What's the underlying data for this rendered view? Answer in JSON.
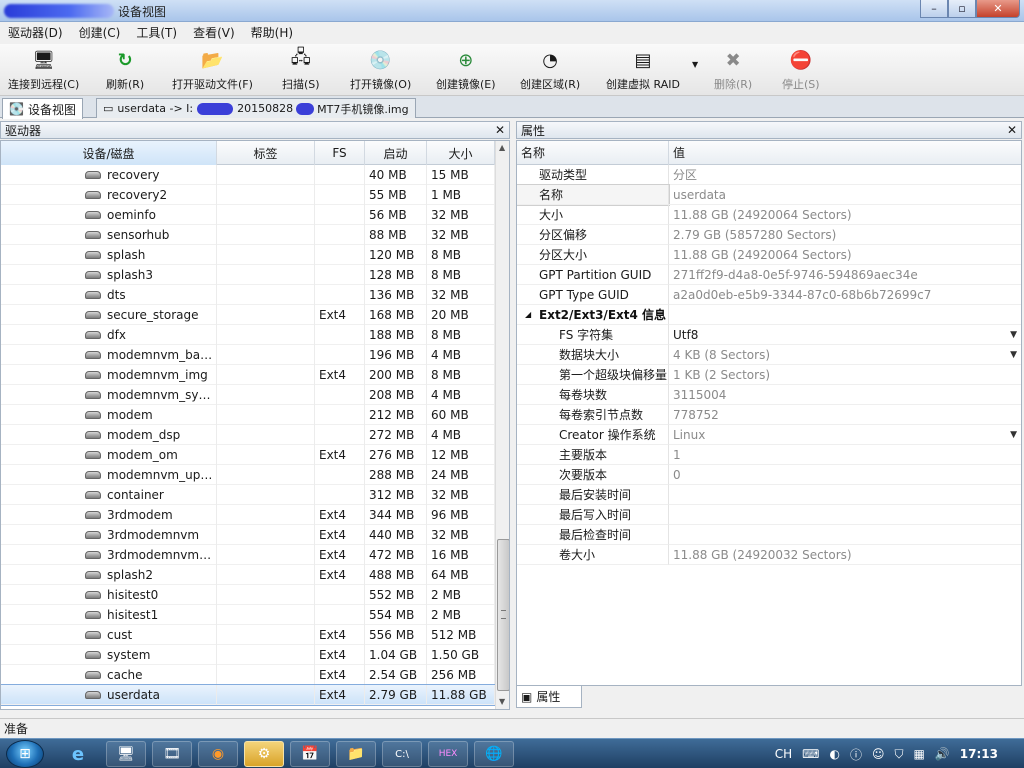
{
  "window": {
    "title": "设备视图",
    "minimize": "–",
    "maximize": "▫",
    "close": "✕"
  },
  "menu": [
    "驱动器(D)",
    "创建(C)",
    "工具(T)",
    "查看(V)",
    "帮助(H)"
  ],
  "toolbar": {
    "connect": "连接到远程(C)",
    "refresh": "刷新(R)",
    "open_driver_file": "打开驱动文件(F)",
    "scan": "扫描(S)",
    "open_image": "打开镜像(O)",
    "create_image": "创建镜像(E)",
    "create_region": "创建区域(R)",
    "create_virtual_raid": "创建虚拟 RAID",
    "delete": "删除(R)",
    "stop": "停止(S)"
  },
  "doc_tabs": {
    "device_view": "设备视图",
    "image_tab_prefix": "userdata -> I:",
    "image_tab_date": "20150828",
    "image_tab_file": "MT7手机镜像.img"
  },
  "left_panel": {
    "title": "驱动器",
    "columns": {
      "device": "设备/磁盘",
      "label": "标签",
      "fs": "FS",
      "start": "启动",
      "size": "大小"
    },
    "rows": [
      {
        "name": "recovery",
        "label": "",
        "fs": "",
        "start": "40 MB",
        "size": "15 MB"
      },
      {
        "name": "recovery2",
        "label": "",
        "fs": "",
        "start": "55 MB",
        "size": "1 MB"
      },
      {
        "name": "oeminfo",
        "label": "",
        "fs": "",
        "start": "56 MB",
        "size": "32 MB"
      },
      {
        "name": "sensorhub",
        "label": "",
        "fs": "",
        "start": "88 MB",
        "size": "32 MB"
      },
      {
        "name": "splash",
        "label": "",
        "fs": "",
        "start": "120 MB",
        "size": "8 MB"
      },
      {
        "name": "splash3",
        "label": "",
        "fs": "",
        "start": "128 MB",
        "size": "8 MB"
      },
      {
        "name": "dts",
        "label": "",
        "fs": "",
        "start": "136 MB",
        "size": "32 MB"
      },
      {
        "name": "secure_storage",
        "label": "",
        "fs": "Ext4",
        "start": "168 MB",
        "size": "20 MB"
      },
      {
        "name": "dfx",
        "label": "",
        "fs": "",
        "start": "188 MB",
        "size": "8 MB"
      },
      {
        "name": "modemnvm_bac...",
        "label": "",
        "fs": "",
        "start": "196 MB",
        "size": "4 MB"
      },
      {
        "name": "modemnvm_img",
        "label": "",
        "fs": "Ext4",
        "start": "200 MB",
        "size": "8 MB"
      },
      {
        "name": "modemnvm_syst...",
        "label": "",
        "fs": "",
        "start": "208 MB",
        "size": "4 MB"
      },
      {
        "name": "modem",
        "label": "",
        "fs": "",
        "start": "212 MB",
        "size": "60 MB"
      },
      {
        "name": "modem_dsp",
        "label": "",
        "fs": "",
        "start": "272 MB",
        "size": "4 MB"
      },
      {
        "name": "modem_om",
        "label": "",
        "fs": "Ext4",
        "start": "276 MB",
        "size": "12 MB"
      },
      {
        "name": "modemnvm_upd...",
        "label": "",
        "fs": "",
        "start": "288 MB",
        "size": "24 MB"
      },
      {
        "name": "container",
        "label": "",
        "fs": "",
        "start": "312 MB",
        "size": "32 MB"
      },
      {
        "name": "3rdmodem",
        "label": "",
        "fs": "Ext4",
        "start": "344 MB",
        "size": "96 MB"
      },
      {
        "name": "3rdmodemnvm",
        "label": "",
        "fs": "Ext4",
        "start": "440 MB",
        "size": "32 MB"
      },
      {
        "name": "3rdmodemnvmb...",
        "label": "",
        "fs": "Ext4",
        "start": "472 MB",
        "size": "16 MB"
      },
      {
        "name": "splash2",
        "label": "",
        "fs": "Ext4",
        "start": "488 MB",
        "size": "64 MB"
      },
      {
        "name": "hisitest0",
        "label": "",
        "fs": "",
        "start": "552 MB",
        "size": "2 MB"
      },
      {
        "name": "hisitest1",
        "label": "",
        "fs": "",
        "start": "554 MB",
        "size": "2 MB"
      },
      {
        "name": "cust",
        "label": "",
        "fs": "Ext4",
        "start": "556 MB",
        "size": "512 MB"
      },
      {
        "name": "system",
        "label": "",
        "fs": "Ext4",
        "start": "1.04 GB",
        "size": "1.50 GB"
      },
      {
        "name": "cache",
        "label": "",
        "fs": "Ext4",
        "start": "2.54 GB",
        "size": "256 MB"
      },
      {
        "name": "userdata",
        "label": "",
        "fs": "Ext4",
        "start": "2.79 GB",
        "size": "11.88 GB",
        "selected": true
      }
    ]
  },
  "right_panel": {
    "title": "属性",
    "columns": {
      "name": "名称",
      "value": "值"
    },
    "props": [
      {
        "name": "驱动类型",
        "value": "分区",
        "indent": 1
      },
      {
        "name": "名称",
        "value": "userdata",
        "indent": 1,
        "sel": true
      },
      {
        "name": "大小",
        "value": "11.88 GB (24920064 Sectors)",
        "indent": 1
      },
      {
        "name": "分区偏移",
        "value": "2.79 GB (5857280 Sectors)",
        "indent": 1
      },
      {
        "name": "分区大小",
        "value": "11.88 GB (24920064 Sectors)",
        "indent": 1
      },
      {
        "name": "GPT Partition GUID",
        "value": "271ff2f9-d4a8-0e5f-9746-594869aec34e",
        "indent": 1
      },
      {
        "name": "GPT Type GUID",
        "value": "a2a0d0eb-e5b9-3344-87c0-68b6b72699c7",
        "indent": 1
      },
      {
        "name": "Ext2/Ext3/Ext4 信息",
        "value": "",
        "indent": 0,
        "group": true
      },
      {
        "name": "FS 字符集",
        "value": "Utf8",
        "indent": 2,
        "dropdown": true,
        "dark": true
      },
      {
        "name": "数据块大小",
        "value": "4 KB (8 Sectors)",
        "indent": 2,
        "dropdown": true
      },
      {
        "name": "第一个超级块偏移量",
        "value": "1 KB (2 Sectors)",
        "indent": 2
      },
      {
        "name": "每卷块数",
        "value": "3115004",
        "indent": 2
      },
      {
        "name": "每卷索引节点数",
        "value": "778752",
        "indent": 2
      },
      {
        "name": "Creator 操作系统",
        "value": "Linux",
        "indent": 2,
        "dropdown": true
      },
      {
        "name": "主要版本",
        "value": "1",
        "indent": 2
      },
      {
        "name": "次要版本",
        "value": "0",
        "indent": 2
      },
      {
        "name": "最后安装时间",
        "value": "",
        "indent": 2
      },
      {
        "name": "最后写入时间",
        "value": "",
        "indent": 2
      },
      {
        "name": "最后检查时间",
        "value": "",
        "indent": 2
      },
      {
        "name": "卷大小",
        "value": "11.88 GB (24920032 Sectors)",
        "indent": 2
      }
    ],
    "bottom_tab": "属性"
  },
  "status": {
    "text": "准备"
  },
  "tray": {
    "lang": "CH",
    "time": "17:13"
  }
}
